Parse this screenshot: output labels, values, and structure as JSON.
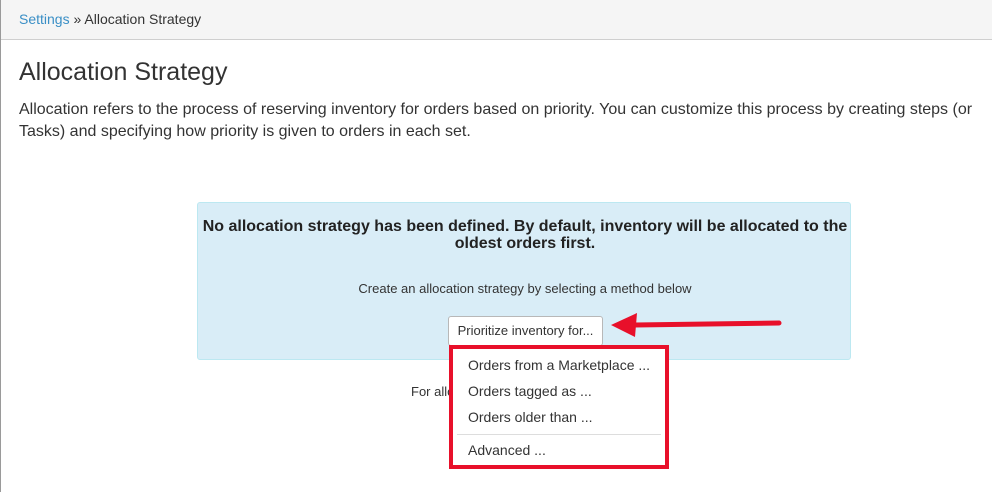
{
  "breadcrumb": {
    "parent": "Settings",
    "separator": "»",
    "current": "Allocation Strategy"
  },
  "page": {
    "title": "Allocation Strategy",
    "description": "Allocation refers to the process of reserving inventory for orders based on priority. You can customize this process by creating steps (or Tasks) and specifying how priority is given to orders in each set."
  },
  "info_box": {
    "heading": "No allocation strategy has been defined. By default, inventory will be allocated to the oldest orders first.",
    "subtext": "Create an allocation strategy by selecting a method below",
    "button_label": "Prioritize inventory for..."
  },
  "footer": {
    "partial_text": "For allo"
  },
  "dropdown": {
    "items": [
      "Orders from a Marketplace ...",
      "Orders tagged as ...",
      "Orders older than ...",
      "Advanced ..."
    ]
  },
  "colors": {
    "link": "#3a8fc6",
    "info_bg": "#d9edf7",
    "annotation_red": "#e8102a"
  }
}
